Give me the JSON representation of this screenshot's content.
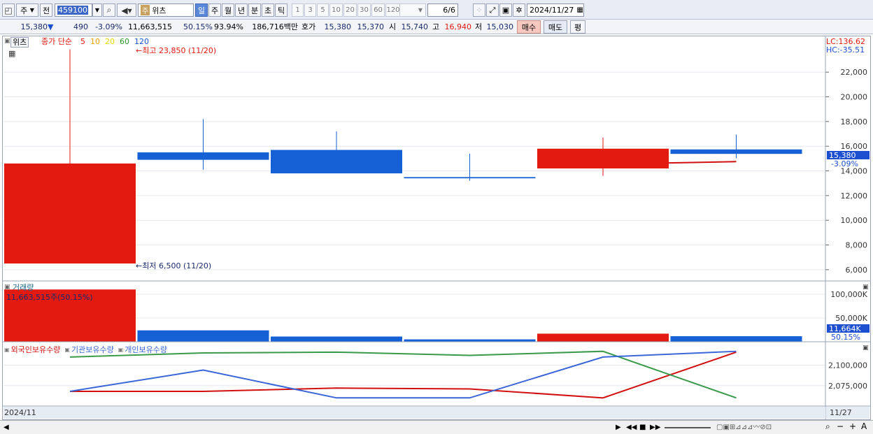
{
  "toolbar": {
    "market_type": "주",
    "prev_label": "전",
    "code": "459100",
    "stock_name": "위츠",
    "period_tabs": [
      "일",
      "주",
      "월",
      "년",
      "분",
      "초",
      "틱"
    ],
    "num_tabs": [
      "1",
      "3",
      "5",
      "10",
      "20",
      "30",
      "60",
      "120"
    ],
    "count": "6",
    "total": "/6",
    "date": "2024/11/27"
  },
  "quote": {
    "price": "15,380",
    "arrow": "▼",
    "change": "490",
    "change_pct": "-3.09%",
    "volume": "11,663,515",
    "turnover": "50.15%",
    "ratio": "93.94%",
    "amount": "186,716백만",
    "hoga_label": "호가",
    "ask": "15,380",
    "bid": "15,370",
    "open_label": "시",
    "open": "15,740",
    "high_label": "고",
    "high": "16,940",
    "low_label": "저",
    "low": "15,030",
    "buy_label": "매수",
    "sell_label": "매도",
    "avg_label": "평"
  },
  "price_panel": {
    "title": "위츠",
    "ma_label": "종가 단순",
    "ma_periods": [
      "5",
      "10",
      "20",
      "60",
      "120"
    ],
    "ma_colors": [
      "#e21a0f",
      "#e8a000",
      "#e8d800",
      "#2a9a2a",
      "#1c4fd0"
    ],
    "lc": "LC:136.62",
    "hc": "HC:-35.51",
    "high_marker": "최고 23,850 (11/20)",
    "low_marker": "최저 6,500 (11/20)",
    "cur_price_tag": "15,380",
    "cur_pct_tag": "-3.09%"
  },
  "volume_panel": {
    "title": "거래량",
    "label": "11,663,515주(50.15%)",
    "cur_tag": "11,664K",
    "cur_pct": "50.15%"
  },
  "holding_panel": {
    "legend": [
      "외국인보유수량",
      "기관보유수량",
      "개인보유수량"
    ]
  },
  "xaxis": {
    "start": "2024/11",
    "end": "11/27"
  },
  "chart_data": [
    {
      "type": "candlestick",
      "title": "위츠",
      "candles": [
        {
          "open": 6500,
          "high": 23850,
          "low": 6500,
          "close": 14600,
          "color": "#e21a0f"
        },
        {
          "open": 15500,
          "high": 18200,
          "low": 14100,
          "close": 14900,
          "color": "#1560d4"
        },
        {
          "open": 15700,
          "high": 17200,
          "low": 14300,
          "close": 13800,
          "color": "#1560d4"
        },
        {
          "open": 13500,
          "high": 15400,
          "low": 13200,
          "close": 13400,
          "color": "#1560d4"
        },
        {
          "open": 14200,
          "high": 16700,
          "low": 13600,
          "close": 15800,
          "color": "#e21a0f"
        },
        {
          "open": 15740,
          "high": 16940,
          "low": 15030,
          "close": 15380,
          "color": "#1560d4"
        }
      ],
      "ma5": {
        "name": "5",
        "values": [
          null,
          null,
          null,
          null,
          14650,
          14750
        ]
      },
      "yticks": [
        6000,
        8000,
        10000,
        12000,
        14000,
        16000,
        18000,
        20000,
        22000
      ],
      "ylim": [
        5200,
        24900
      ]
    },
    {
      "type": "bar",
      "title": "거래량",
      "values": [
        110000,
        24000,
        11000,
        5000,
        17000,
        11664
      ],
      "colors": [
        "#e21a0f",
        "#1560d4",
        "#1560d4",
        "#1560d4",
        "#e21a0f",
        "#1560d4"
      ],
      "ytick_labels": [
        "100,000K",
        "50,000K"
      ],
      "yticks": [
        100000,
        50000
      ],
      "ylim": [
        0,
        125000
      ]
    },
    {
      "type": "line",
      "series": [
        {
          "name": "외국인보유수량",
          "color": "#d21010",
          "values": [
            2068000,
            2068000,
            2072000,
            2071000,
            2060000,
            2116000
          ]
        },
        {
          "name": "기관보유수량",
          "color": "#3a9a4a",
          "values": [
            2110000,
            2115000,
            2116000,
            2112000,
            2117000,
            2060000
          ]
        },
        {
          "name": "개인보유수량",
          "color": "#3a66d8",
          "values": [
            2068000,
            2094000,
            2060000,
            2060000,
            2110000,
            2117000
          ]
        }
      ],
      "yticks": [
        2100000,
        2075000
      ],
      "ytick_labels": [
        "2,100,000",
        "2,075,000"
      ],
      "ylim": [
        2050000,
        2127000
      ]
    }
  ]
}
